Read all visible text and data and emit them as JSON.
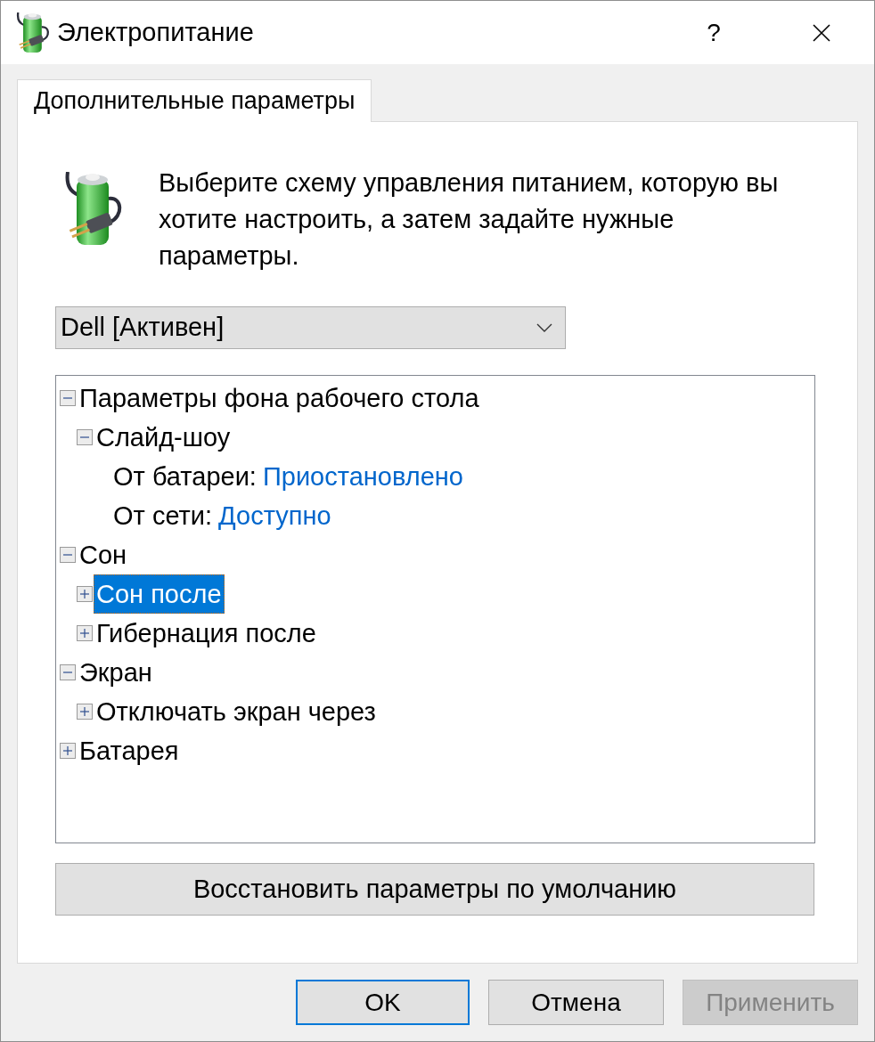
{
  "window": {
    "title": "Электропитание",
    "help_label": "?"
  },
  "tabs": [
    {
      "label": "Дополнительные параметры",
      "selected": true
    }
  ],
  "description": "Выберите схему управления питанием, которую вы хотите настроить, а затем задайте нужные параметры.",
  "plan_dropdown": {
    "value": "Dell [Активен]"
  },
  "tree": [
    {
      "kind": "group",
      "label": "Параметры фона рабочего стола",
      "expanded": true,
      "selected": false,
      "children": [
        {
          "kind": "group",
          "label": "Слайд-шоу",
          "expanded": true,
          "selected": false,
          "children": [
            {
              "kind": "setting",
              "label": "От батареи:",
              "value": "Приостановлено",
              "selected": false
            },
            {
              "kind": "setting",
              "label": "От сети:",
              "value": "Доступно",
              "selected": false
            }
          ]
        }
      ]
    },
    {
      "kind": "group",
      "label": "Сон",
      "expanded": true,
      "selected": false,
      "children": [
        {
          "kind": "group",
          "label": "Сон после",
          "expanded": false,
          "selected": true
        },
        {
          "kind": "group",
          "label": "Гибернация после",
          "expanded": false,
          "selected": false
        }
      ]
    },
    {
      "kind": "group",
      "label": "Экран",
      "expanded": true,
      "selected": false,
      "children": [
        {
          "kind": "group",
          "label": "Отключать экран через",
          "expanded": false,
          "selected": false
        }
      ]
    },
    {
      "kind": "group",
      "label": "Батарея",
      "expanded": false,
      "selected": false
    }
  ],
  "reset_button": {
    "label": "Восстановить параметры по умолчанию"
  },
  "buttons": [
    {
      "label": "OK",
      "default": true,
      "disabled": false
    },
    {
      "label": "Отмена",
      "default": false,
      "disabled": false
    },
    {
      "label": "Применить",
      "default": false,
      "disabled": true
    }
  ]
}
